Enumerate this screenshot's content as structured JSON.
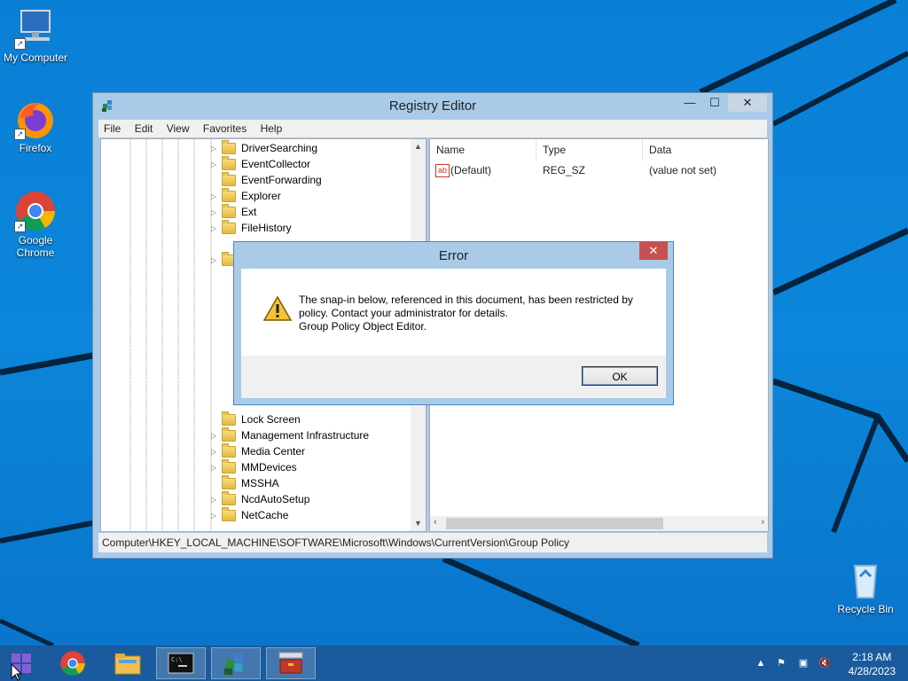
{
  "desktop": {
    "icons": [
      {
        "label": "My Computer"
      },
      {
        "label": "Firefox"
      },
      {
        "label": "Google Chrome"
      },
      {
        "label": "Recycle Bin"
      }
    ]
  },
  "registry_editor": {
    "title": "Registry Editor",
    "menu": [
      "File",
      "Edit",
      "View",
      "Favorites",
      "Help"
    ],
    "tree_items": [
      "DriverSearching",
      "EventCollector",
      "EventForwarding",
      "Explorer",
      "Ext",
      "FileHistory",
      "Lock Screen",
      "Management Infrastructure",
      "Media Center",
      "MMDevices",
      "MSSHA",
      "NcdAutoSetup",
      "NetCache"
    ],
    "columns": {
      "name": "Name",
      "type": "Type",
      "data": "Data"
    },
    "values": [
      {
        "name": "(Default)",
        "type": "REG_SZ",
        "data": "(value not set)"
      }
    ],
    "status_path": "Computer\\HKEY_LOCAL_MACHINE\\SOFTWARE\\Microsoft\\Windows\\CurrentVersion\\Group Policy"
  },
  "error_dialog": {
    "title": "Error",
    "message_lines": [
      "The snap-in below, referenced in this document, has been restricted by",
      "policy. Contact your administrator for details.",
      "Group Policy Object Editor."
    ],
    "ok_label": "OK"
  },
  "taskbar": {
    "time": "2:18 AM",
    "date": "4/28/2023"
  },
  "colors": {
    "desktop": "#0a7fd6",
    "taskbar": "#1a5b9e",
    "window_frame": "#a9cbe8",
    "close_button": "#c75050"
  }
}
